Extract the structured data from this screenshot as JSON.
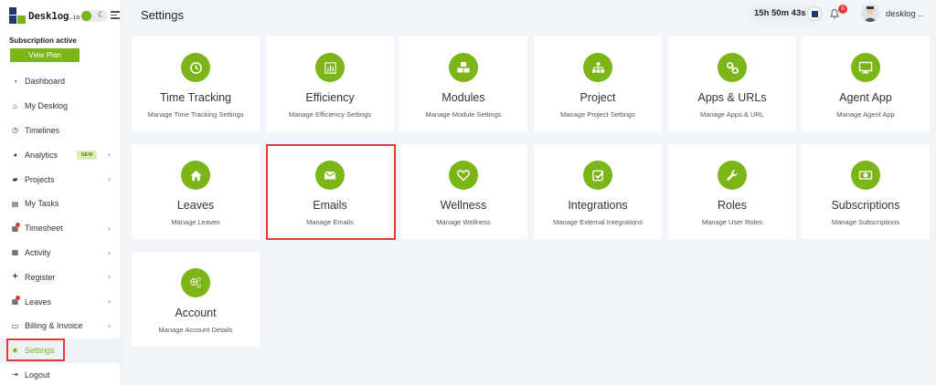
{
  "brand": {
    "name_main": "Desk1og",
    "name_suffix": ".io"
  },
  "subscription": {
    "status": "Subscription active",
    "view_plan_label": "View Plan"
  },
  "nav": {
    "items": [
      {
        "label": "Dashboard",
        "icon": "dashboard-icon"
      },
      {
        "label": "My Desklog",
        "icon": "home-icon"
      },
      {
        "label": "Timelines",
        "icon": "clock-icon"
      },
      {
        "label": "Analytics",
        "icon": "pie-icon",
        "badge": "NEW",
        "chevron": "›"
      },
      {
        "label": "Projects",
        "icon": "folder-icon",
        "chevron": "›"
      },
      {
        "label": "My Tasks",
        "icon": "tasks-icon"
      },
      {
        "label": "Timesheet",
        "icon": "calendar-icon",
        "chevron": "›"
      },
      {
        "label": "Activity",
        "icon": "grid-icon",
        "chevron": "›"
      },
      {
        "label": "Register",
        "icon": "plus-icon",
        "chevron": "›"
      },
      {
        "label": "Leaves",
        "icon": "calendar-icon",
        "chevron": "›"
      },
      {
        "label": "Billing & Invoice",
        "icon": "invoice-icon",
        "chevron": "›"
      },
      {
        "label": "Settings",
        "icon": "gear-icon",
        "active": true
      },
      {
        "label": "Logout",
        "icon": "logout-icon"
      }
    ]
  },
  "header": {
    "title": "Settings",
    "timer": "15h 50m 43s",
    "notification_count": "0",
    "user_name": "desklog ..",
    "accent_color": "#7cb518",
    "alert_color": "#e53935"
  },
  "cards": [
    {
      "title": "Time Tracking",
      "subtitle": "Manage Time Tracking Settings",
      "icon": "clock-icon"
    },
    {
      "title": "Efficiency",
      "subtitle": "Manage Efficiency Settings",
      "icon": "bar-chart-icon"
    },
    {
      "title": "Modules",
      "subtitle": "Manage Module Settings",
      "icon": "cubes-icon"
    },
    {
      "title": "Project",
      "subtitle": "Manage Project Settings",
      "icon": "sitemap-icon"
    },
    {
      "title": "Apps & URLs",
      "subtitle": "Manage Apps & URL",
      "icon": "link-icon"
    },
    {
      "title": "Agent App",
      "subtitle": "Manage Agent App",
      "icon": "monitor-icon"
    },
    {
      "title": "Leaves",
      "subtitle": "Manage Leaves",
      "icon": "home-icon"
    },
    {
      "title": "Emails",
      "subtitle": "Manage Emails",
      "icon": "envelope-icon"
    },
    {
      "title": "Wellness",
      "subtitle": "Manage Wellness",
      "icon": "heart-icon"
    },
    {
      "title": "Integrations",
      "subtitle": "Manage External Integrations",
      "icon": "check-square-icon"
    },
    {
      "title": "Roles",
      "subtitle": "Manage User Roles",
      "icon": "wrench-icon"
    },
    {
      "title": "Subscriptions",
      "subtitle": "Manage Subscriptions",
      "icon": "money-icon"
    },
    {
      "title": "Account",
      "subtitle": "Manage Account Details",
      "icon": "gears-icon"
    }
  ]
}
